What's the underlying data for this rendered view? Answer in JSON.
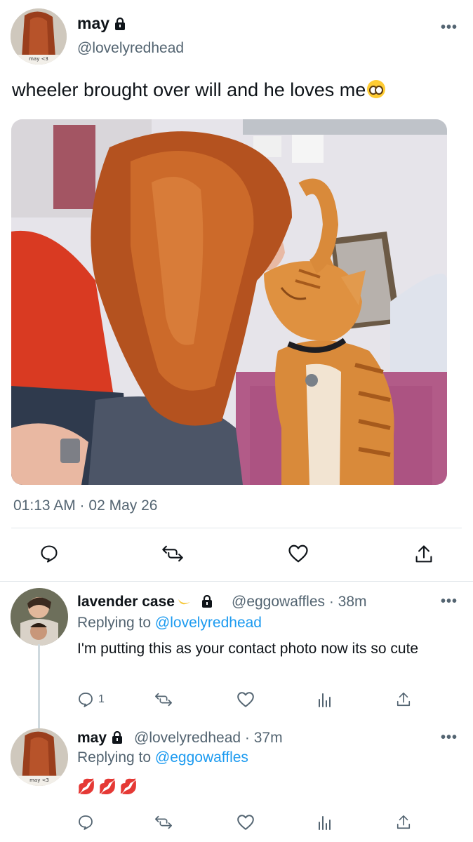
{
  "tweet": {
    "author_name": "may",
    "author_handle": "@lovelyredhead",
    "avatar_caption": "may <3",
    "text": "wheeler brought over will and he loves me",
    "emoji": "pleading-face-emoji",
    "timestamp": "01:13 AM · 02 May 26",
    "image_alt": "photo of a woman with long red hair touching noses with an orange tabby cat"
  },
  "replies": [
    {
      "author_name": "lavender case",
      "author_handle": "@eggowaffles",
      "time": "· 38m",
      "replying_label": "Replying to",
      "replying_to": "@lovelyredhead",
      "text": "I'm putting this as your contact photo now its so cute",
      "reply_count": "1"
    },
    {
      "author_name": "may",
      "author_handle": "@lovelyredhead",
      "time": "· 37m",
      "avatar_caption": "may <3",
      "replying_label": "Replying to",
      "replying_to": "@eggowaffles",
      "text": "💋💋💋"
    }
  ],
  "icons": {
    "more": "•••",
    "colors": {
      "link": "#1d9bf0",
      "muted": "#536471",
      "text": "#0f1419"
    }
  }
}
